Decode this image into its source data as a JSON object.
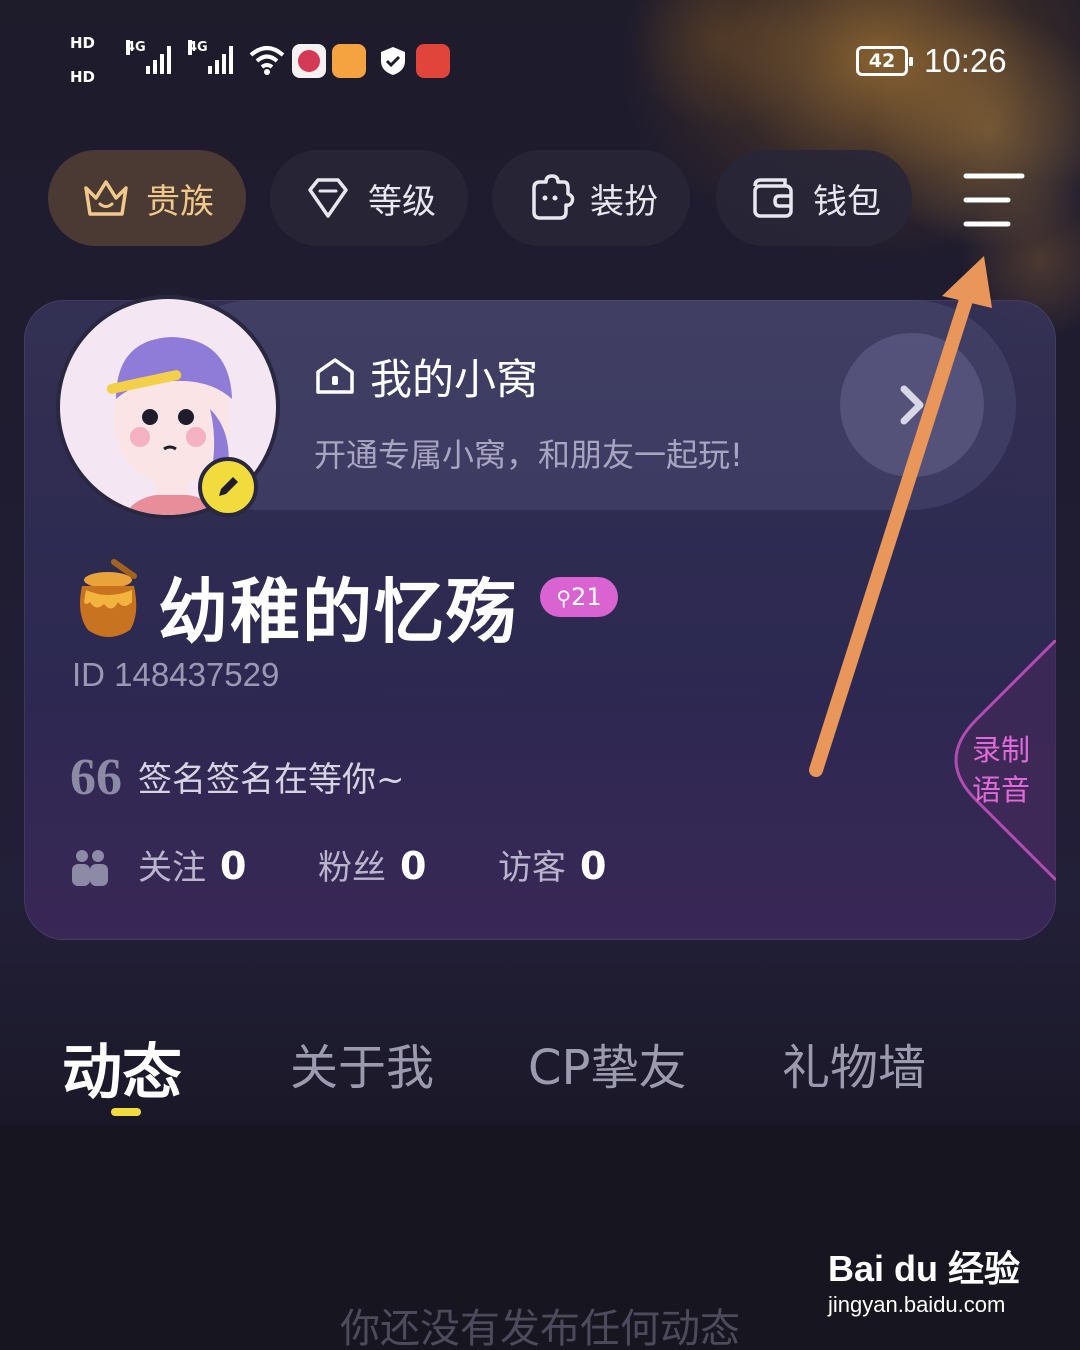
{
  "status_bar": {
    "hd1": "HD",
    "hd2": "HD",
    "net1": "4G",
    "net2": "4G",
    "battery": "42",
    "time": "10:26"
  },
  "top_actions": [
    {
      "label": "贵族",
      "icon": "crown-icon"
    },
    {
      "label": "等级",
      "icon": "diamond-icon"
    },
    {
      "label": "装扮",
      "icon": "puzzle-icon"
    },
    {
      "label": "钱包",
      "icon": "wallet-icon"
    }
  ],
  "nest": {
    "title": "我的小窝",
    "subtitle": "开通专属小窝，和朋友一起玩!"
  },
  "profile": {
    "nickname": "幼稚的忆殇",
    "level": "21",
    "user_id": "ID 148437529",
    "signature_quote": "66",
    "signature": "签名签名在等你~",
    "stats": [
      {
        "label": "关注",
        "value": "0"
      },
      {
        "label": "粉丝",
        "value": "0"
      },
      {
        "label": "访客",
        "value": "0"
      }
    ],
    "record_voice": "录制语音"
  },
  "tabs": [
    {
      "label": "动态",
      "active": true
    },
    {
      "label": "关于我",
      "active": false
    },
    {
      "label": "CP挚友",
      "active": false
    },
    {
      "label": "礼物墙",
      "active": false
    }
  ],
  "feed": {
    "empty_text": "你还没有发布任何动态"
  },
  "watermark": {
    "logo": "Bai du 经验",
    "url": "jingyan.baidu.com"
  },
  "colors": {
    "background": "#1a1827",
    "accent_gold": "#f1c98b",
    "level_badge": "#d964d1",
    "tab_indicator": "#f2dc3d",
    "annotation_arrow": "#e8965a"
  }
}
